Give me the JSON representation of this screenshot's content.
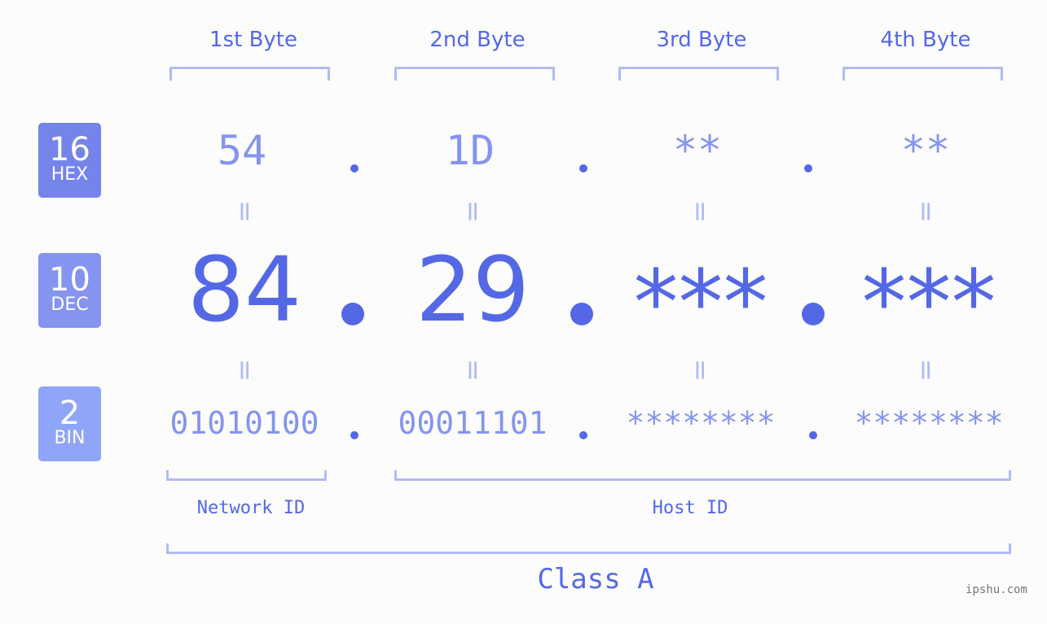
{
  "bytes": [
    {
      "label": "1st Byte",
      "hex": "54",
      "dec": "84",
      "bin": "01010100"
    },
    {
      "label": "2nd Byte",
      "hex": "1D",
      "dec": "29",
      "bin": "00011101"
    },
    {
      "label": "3rd Byte",
      "hex": "**",
      "dec": "***",
      "bin": "********"
    },
    {
      "label": "4th Byte",
      "hex": "**",
      "dec": "***",
      "bin": "********"
    }
  ],
  "bases": {
    "hex": {
      "number": "16",
      "label": "HEX",
      "color": "#7584ea"
    },
    "dec": {
      "number": "10",
      "label": "DEC",
      "color": "#8594ef"
    },
    "bin": {
      "number": "2",
      "label": "BIN",
      "color": "#8fa5f7"
    }
  },
  "equals_symbol": "=",
  "separator": ".",
  "network_id_label": "Network ID",
  "host_id_label": "Host ID",
  "class_label": "Class A",
  "watermark": "ipshu.com",
  "colors": {
    "accent": "#5468e6",
    "light": "#8594ef",
    "bracket": "#b1bbf5"
  }
}
